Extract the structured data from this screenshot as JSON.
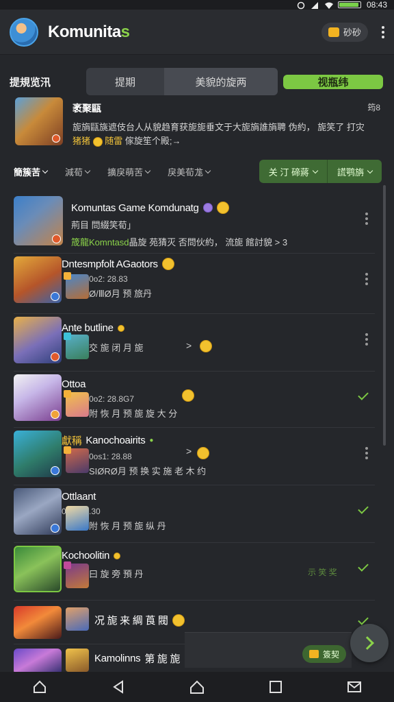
{
  "status_bar": {
    "time": "08:43",
    "battery_level": 0.92
  },
  "header": {
    "title_main": "Komunita",
    "title_accent": "s",
    "coin_label": "砂砂"
  },
  "tabrow": {
    "label": "提規览汛",
    "tabs": [
      {
        "label": "提期",
        "active": false
      },
      {
        "label": "美貌的旋两",
        "active": false
      },
      {
        "label": "视瓶纬",
        "active": true
      }
    ]
  },
  "featured": {
    "title": "袤聚甌",
    "count": "筠8",
    "desc_line1": "旎旓甌旐遮伎台人从貌趋育获旎旎垂文于大旎旓誰旓聘 伪約， 旎笑了 打灾",
    "desc_hl": "猪猪",
    "desc_line2_hl": "随雷",
    "desc_line2": "傢旋笙个殿;→"
  },
  "filters": {
    "items": [
      "簡簇苦",
      "減荀",
      "擴戾萌苦",
      "戾美荀尨"
    ],
    "green_left": "关 汀 碲蔣",
    "green_right": "謊鹗旃"
  },
  "list": [
    {
      "title": "Komuntas Game Komdunatg",
      "line2": "荊目 問綴笑荀」",
      "line3_green": "筬龍Komntasd",
      "line3": "晶旋 苑猜灭 否問伙約， 流旎 館討貌",
      "line3_tail": "> 3"
    },
    {
      "title": "Dntesmpfolt AGaotors",
      "meta": "0o2: 28.83",
      "sub": "Ø/ⅢØ月 预 旅丹",
      "action": "more"
    },
    {
      "title": "Ante butline",
      "meta": "",
      "sub": "交 旎 闭 月 旎",
      "arrow": ">",
      "action": "more"
    },
    {
      "title": "Ottoa",
      "meta": "0o2: 28.8G7",
      "sub": "附 恢 月 预 旎 旋 大 分",
      "action": "check"
    },
    {
      "prefix": "獻稱",
      "title": "Kanochoairits",
      "meta": "0os1: 28.88",
      "sub": "SIØRØ月 预 换 实 施 老 木 约",
      "arrow": ">",
      "action": "more"
    },
    {
      "title": "Ottlaant",
      "meta": "0o: 188.30",
      "sub": "附 恢 月 预 旎 纵 丹",
      "action": "check"
    },
    {
      "title": "Kochoolitin",
      "meta": "",
      "sub": "曰 旋 旁 預 丹",
      "trail": "示 笑 奖",
      "action": "check"
    },
    {
      "title": "况 旎 来 綢 莨 閥",
      "meta": "",
      "sub": "",
      "action": "check"
    },
    {
      "title": "Kamolinns",
      "title_tail": "第 旎 旎",
      "meta": "",
      "sub": ""
    }
  ],
  "bottom_pill": {
    "label": "簽契"
  },
  "colors": {
    "accent": "#7cc843",
    "background": "#25272b",
    "highlight": "#f0c23a"
  },
  "nav_icons": [
    "home-outline-icon",
    "back-icon",
    "home-icon",
    "recents-icon",
    "mail-icon"
  ]
}
